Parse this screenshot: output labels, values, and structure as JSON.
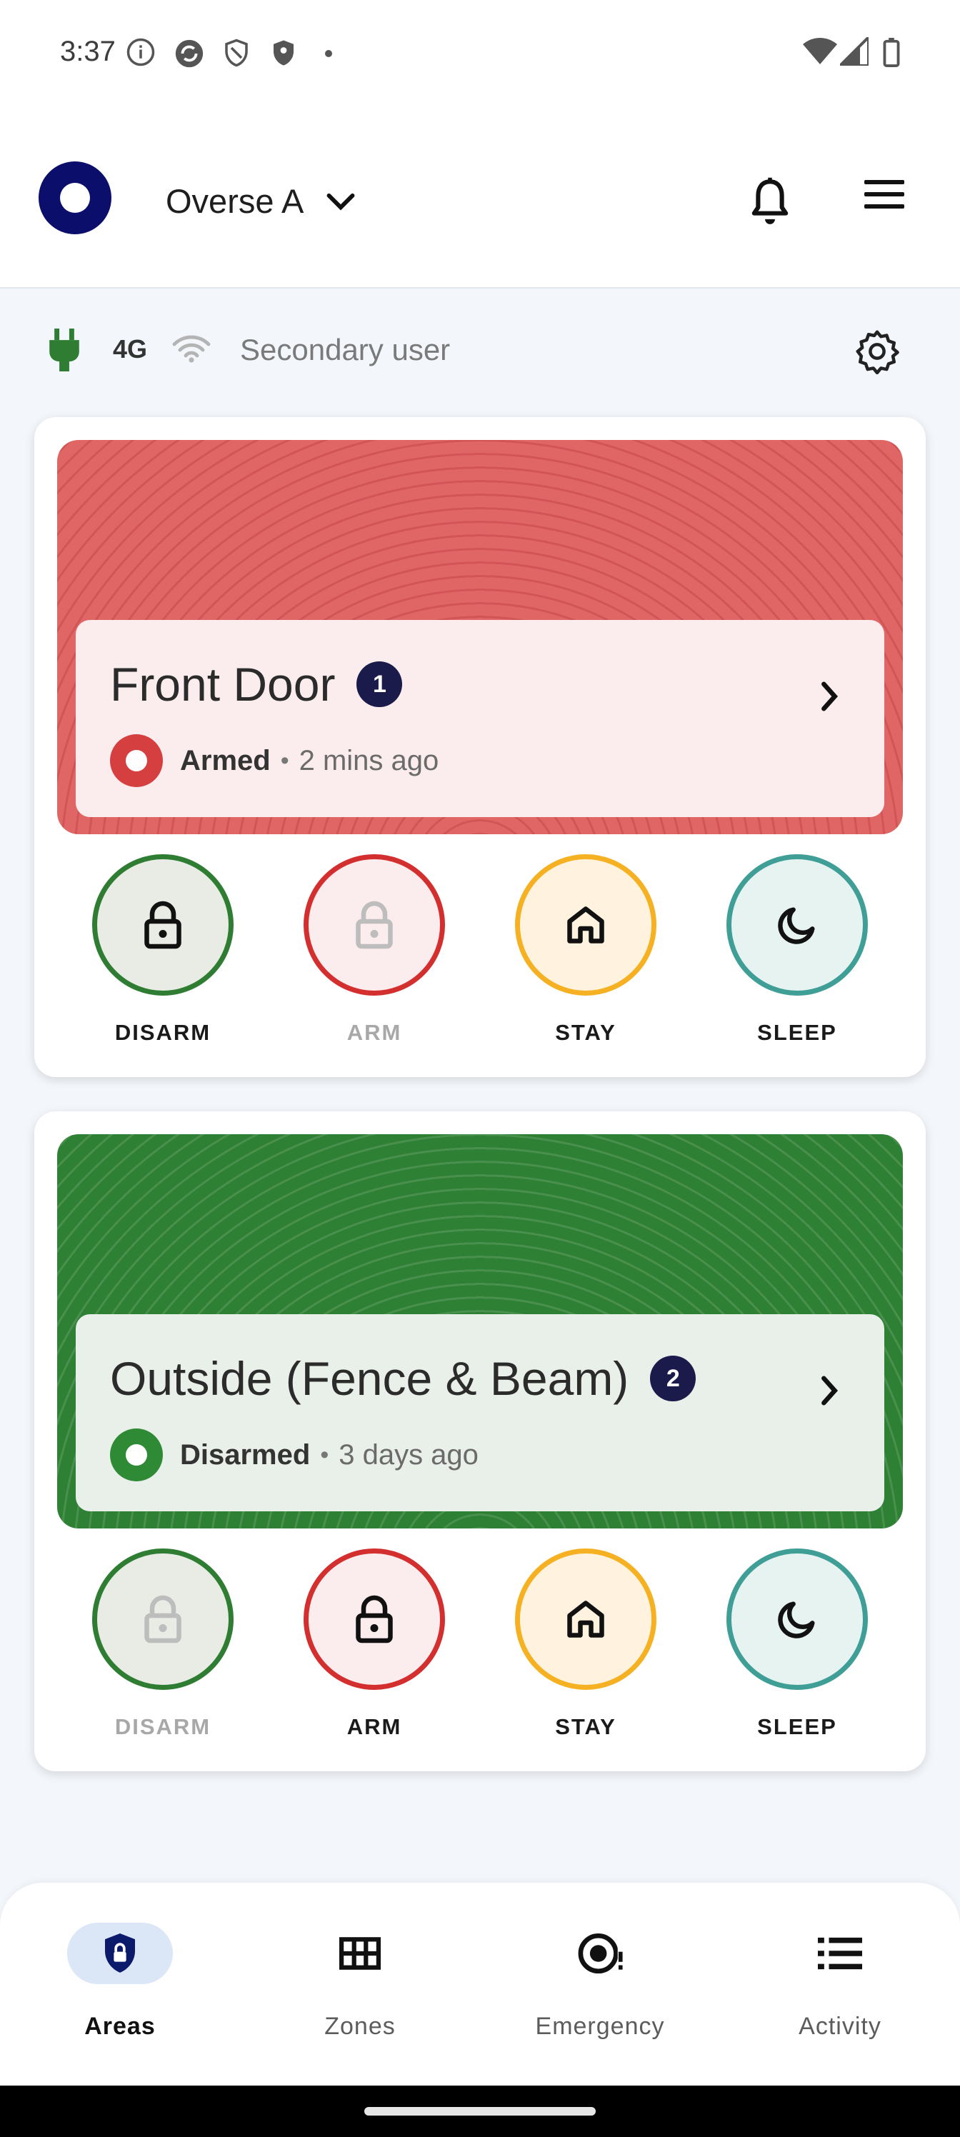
{
  "status_bar": {
    "time": "3:37",
    "left_icons": [
      "info-icon",
      "sync-icon",
      "shield-outline-icon",
      "shield-filled-icon",
      "dot-icon"
    ],
    "right_icons": [
      "wifi-icon",
      "cellular-icon",
      "battery-icon"
    ]
  },
  "header": {
    "site_name": "Overse A",
    "icons": [
      "logo-icon",
      "chevron-down-icon",
      "bell-icon",
      "hamburger-menu-icon"
    ]
  },
  "connection": {
    "network": "4G",
    "user_role": "Secondary user",
    "icons": [
      "power-plug-icon",
      "wifi-icon",
      "gear-icon"
    ]
  },
  "areas": [
    {
      "name": "Front Door",
      "badge": "1",
      "status": "Armed",
      "separator": "•",
      "time_ago": "2 mins ago",
      "theme": "#e06666",
      "actions": [
        {
          "label": "DISARM",
          "icon": "lock-icon",
          "enabled": true
        },
        {
          "label": "ARM",
          "icon": "lock-icon",
          "enabled": false
        },
        {
          "label": "STAY",
          "icon": "home-icon",
          "enabled": true
        },
        {
          "label": "SLEEP",
          "icon": "moon-icon",
          "enabled": true
        }
      ]
    },
    {
      "name": "Outside (Fence & Beam)",
      "badge": "2",
      "status": "Disarmed",
      "separator": "•",
      "time_ago": "3 days ago",
      "theme": "#2e8034",
      "actions": [
        {
          "label": "DISARM",
          "icon": "lock-icon",
          "enabled": false
        },
        {
          "label": "ARM",
          "icon": "lock-icon",
          "enabled": true
        },
        {
          "label": "STAY",
          "icon": "home-icon",
          "enabled": true
        },
        {
          "label": "SLEEP",
          "icon": "moon-icon",
          "enabled": true
        }
      ]
    }
  ],
  "bottom_nav": [
    {
      "label": "Areas",
      "icon": "shield-lock-icon",
      "active": true
    },
    {
      "label": "Zones",
      "icon": "grid-icon",
      "active": false
    },
    {
      "label": "Emergency",
      "icon": "emergency-icon",
      "active": false
    },
    {
      "label": "Activity",
      "icon": "list-icon",
      "active": false
    }
  ],
  "colors": {
    "disarm": "#2e7d32",
    "arm": "#d32f2f",
    "stay": "#f5b121",
    "sleep": "#3f9e96",
    "badge": "#1b1b4b",
    "logo": "#0b0f6b"
  }
}
